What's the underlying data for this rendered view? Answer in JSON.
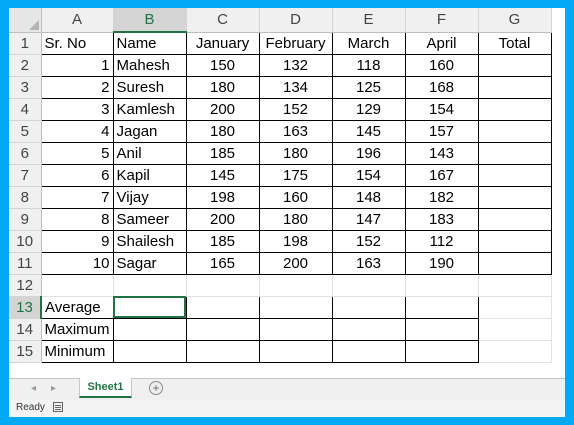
{
  "columns": [
    "A",
    "B",
    "C",
    "D",
    "E",
    "F",
    "G"
  ],
  "rows": [
    {
      "n": "1",
      "cells": [
        "Sr. No",
        "Name",
        "January",
        "February",
        "March",
        "April",
        "Total"
      ]
    },
    {
      "n": "2",
      "cells": [
        "1",
        "Mahesh",
        "150",
        "132",
        "118",
        "160",
        ""
      ]
    },
    {
      "n": "3",
      "cells": [
        "2",
        "Suresh",
        "180",
        "134",
        "125",
        "168",
        ""
      ]
    },
    {
      "n": "4",
      "cells": [
        "3",
        "Kamlesh",
        "200",
        "152",
        "129",
        "154",
        ""
      ]
    },
    {
      "n": "5",
      "cells": [
        "4",
        "Jagan",
        "180",
        "163",
        "145",
        "157",
        ""
      ]
    },
    {
      "n": "6",
      "cells": [
        "5",
        "Anil",
        "185",
        "180",
        "196",
        "143",
        ""
      ]
    },
    {
      "n": "7",
      "cells": [
        "6",
        "Kapil",
        "145",
        "175",
        "154",
        "167",
        ""
      ]
    },
    {
      "n": "8",
      "cells": [
        "7",
        "Vijay",
        "198",
        "160",
        "148",
        "182",
        ""
      ]
    },
    {
      "n": "9",
      "cells": [
        "8",
        "Sameer",
        "200",
        "180",
        "147",
        "183",
        ""
      ]
    },
    {
      "n": "10",
      "cells": [
        "9",
        "Shailesh",
        "185",
        "198",
        "152",
        "112",
        ""
      ]
    },
    {
      "n": "11",
      "cells": [
        "10",
        "Sagar",
        "165",
        "200",
        "163",
        "190",
        ""
      ]
    },
    {
      "n": "12",
      "cells": [
        "",
        "",
        "",
        "",
        "",
        "",
        ""
      ]
    },
    {
      "n": "13",
      "cells": [
        "Average",
        "",
        "",
        "",
        "",
        "",
        ""
      ]
    },
    {
      "n": "14",
      "cells": [
        "Maximum",
        "",
        "",
        "",
        "",
        "",
        ""
      ]
    },
    {
      "n": "15",
      "cells": [
        "Minimum",
        "",
        "",
        "",
        "",
        "",
        ""
      ]
    }
  ],
  "selected_column": "B",
  "selected_row": "13",
  "sheet_tab": "Sheet1",
  "status": "Ready",
  "accent_color": "#217346",
  "frame_color": "#03a9f4"
}
